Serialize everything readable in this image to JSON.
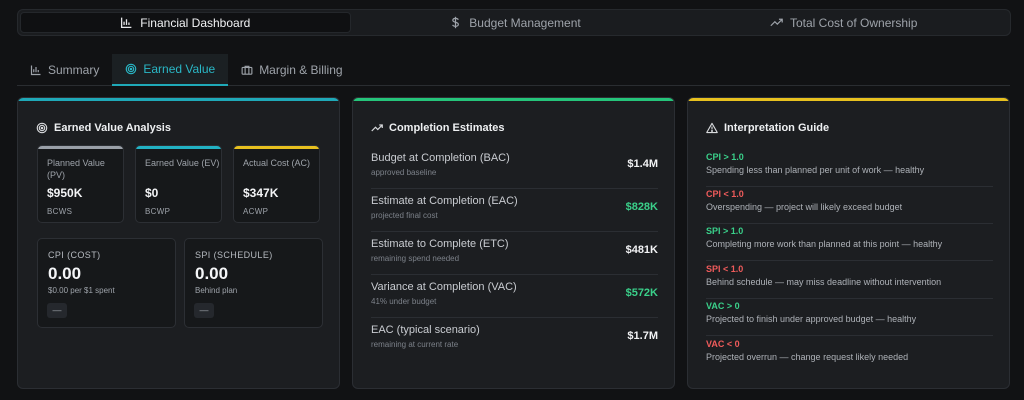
{
  "topnav": {
    "tabs": [
      {
        "label": "Financial Dashboard",
        "icon": "bar-chart-icon",
        "active": true
      },
      {
        "label": "Budget Management",
        "icon": "dollar-icon",
        "active": false
      },
      {
        "label": "Total Cost of Ownership",
        "icon": "trend-up-icon",
        "active": false
      }
    ]
  },
  "subtabs": [
    {
      "label": "Summary",
      "icon": "bar-chart-icon",
      "active": false
    },
    {
      "label": "Earned Value",
      "icon": "target-icon",
      "active": true
    },
    {
      "label": "Margin & Billing",
      "icon": "briefcase-icon",
      "active": false
    }
  ],
  "earned_value": {
    "title": "Earned Value Analysis",
    "cards": [
      {
        "label": "Planned Value (PV)",
        "value": "$950K",
        "sub": "BCWS",
        "color": "#9aa0a8"
      },
      {
        "label": "Earned Value (EV)",
        "value": "$0",
        "sub": "BCWP",
        "color": "#22b2c4"
      },
      {
        "label": "Actual Cost (AC)",
        "value": "$347K",
        "sub": "ACWP",
        "color": "#e7c01f"
      }
    ],
    "indices": [
      {
        "label": "CPI (COST)",
        "value": "0.00",
        "sub": "$0.00 per $1 spent",
        "badge": "—"
      },
      {
        "label": "SPI (SCHEDULE)",
        "value": "0.00",
        "sub": "Behind plan",
        "badge": "—"
      }
    ]
  },
  "completion": {
    "title": "Completion Estimates",
    "rows": [
      {
        "label": "Budget at Completion (BAC)",
        "sub": "approved baseline",
        "value": "$1.4M",
        "color": "#f2f3f5"
      },
      {
        "label": "Estimate at Completion (EAC)",
        "sub": "projected final cost",
        "value": "$828K",
        "color": "#3ad08a"
      },
      {
        "label": "Estimate to Complete (ETC)",
        "sub": "remaining spend needed",
        "value": "$481K",
        "color": "#f2f3f5"
      },
      {
        "label": "Variance at Completion (VAC)",
        "sub": "41% under budget",
        "value": "$572K",
        "color": "#3ad08a"
      },
      {
        "label": "EAC (typical scenario)",
        "sub": "remaining at current rate",
        "value": "$1.7M",
        "color": "#f2f3f5"
      }
    ]
  },
  "guide": {
    "title": "Interpretation Guide",
    "rows": [
      {
        "head": "CPI > 1.0",
        "desc": "Spending less than planned per unit of work — healthy",
        "color": "#3ad08a"
      },
      {
        "head": "CPI < 1.0",
        "desc": "Overspending — project will likely exceed budget",
        "color": "#ef5b5b"
      },
      {
        "head": "SPI > 1.0",
        "desc": "Completing more work than planned at this point — healthy",
        "color": "#3ad08a"
      },
      {
        "head": "SPI < 1.0",
        "desc": "Behind schedule — may miss deadline without intervention",
        "color": "#ef5b5b"
      },
      {
        "head": "VAC > 0",
        "desc": "Projected to finish under approved budget — healthy",
        "color": "#3ad08a"
      },
      {
        "head": "VAC < 0",
        "desc": "Projected overrun — change request likely needed",
        "color": "#ef5b5b"
      }
    ]
  },
  "colors": {
    "ev_accent": "#1fa9b8",
    "completion_accent": "#25c47a",
    "guide_accent": "#e7c01f"
  }
}
